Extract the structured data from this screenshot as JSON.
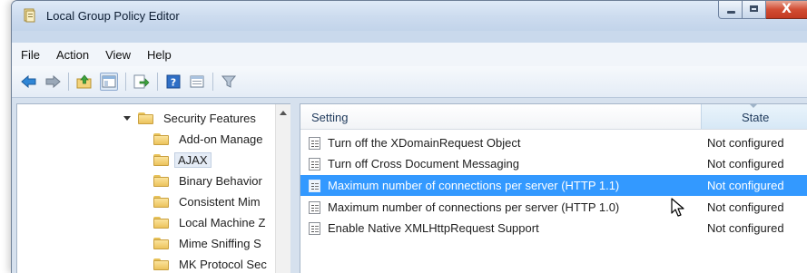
{
  "window": {
    "title": "Local Group Policy Editor",
    "caption_buttons": [
      "minimize",
      "maximize",
      "close"
    ],
    "close_glyph": "X"
  },
  "menu": [
    "File",
    "Action",
    "View",
    "Help"
  ],
  "toolbar": {
    "icons": [
      "back-arrow-icon",
      "forward-arrow-icon",
      "up-folder-icon",
      "show-hide-tree-icon",
      "export-list-icon",
      "help-icon",
      "properties-view-icon",
      "filter-icon"
    ]
  },
  "tree": {
    "parent": "Security Features",
    "children": [
      "Add-on Manage",
      "AJAX",
      "Binary Behavior",
      "Consistent Mim",
      "Local Machine Z",
      "Mime Sniffing S",
      "MK Protocol Sec"
    ],
    "selected_index": 1
  },
  "list": {
    "columns": {
      "setting": "Setting",
      "state": "State"
    },
    "rows": [
      {
        "setting": "Turn off the XDomainRequest Object",
        "state": "Not configured"
      },
      {
        "setting": "Turn off Cross Document Messaging",
        "state": "Not configured"
      },
      {
        "setting": "Maximum number of connections per server (HTTP 1.1)",
        "state": "Not configured"
      },
      {
        "setting": "Maximum number of connections per server (HTTP 1.0)",
        "state": "Not configured"
      },
      {
        "setting": "Enable Native XMLHttpRequest Support",
        "state": "Not configured"
      }
    ],
    "selected_index": 2
  },
  "colors": {
    "selection": "#3399ff",
    "close_button": "#c9452b",
    "folder": "#f3d37a"
  }
}
